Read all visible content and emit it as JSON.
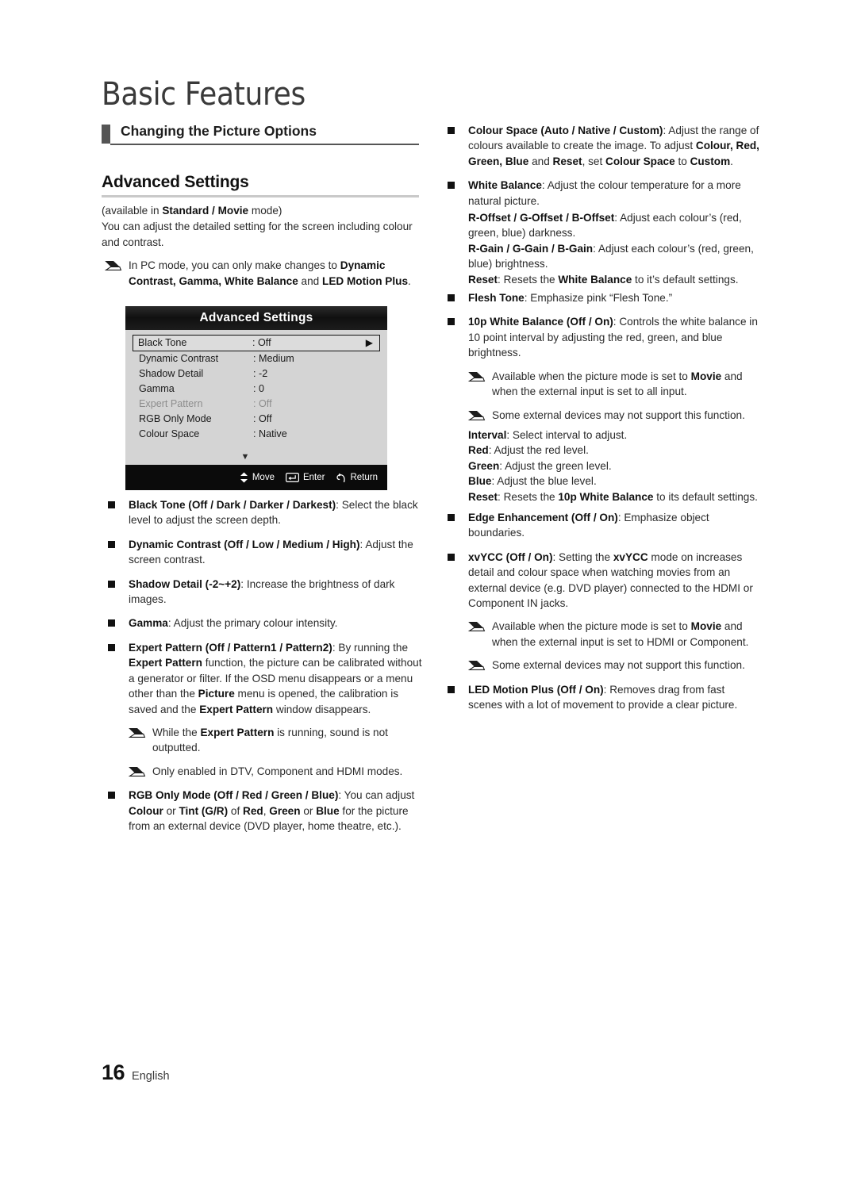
{
  "chapter": {
    "title": "Basic Features"
  },
  "section": {
    "label": "Changing the Picture Options"
  },
  "subsection": {
    "label": "Advanced Settings"
  },
  "intro": {
    "availability_prefix": "(available in ",
    "availability_bold": "Standard / Movie",
    "availability_suffix": " mode)",
    "description": "You can adjust the detailed setting for the screen including colour and contrast.",
    "note_pc_1": "In PC mode, you can only make changes to ",
    "note_pc_bold1": "Dynamic Contrast, Gamma, White Balance",
    "note_pc_2": " and ",
    "note_pc_bold2": "LED Motion Plus",
    "note_pc_3": "."
  },
  "osd": {
    "title": "Advanced Settings",
    "rows": [
      {
        "label": "Black Tone",
        "value": ": Off",
        "selected": true,
        "disabled": false,
        "arrow": "▶"
      },
      {
        "label": "Dynamic Contrast",
        "value": ": Medium",
        "selected": false,
        "disabled": false
      },
      {
        "label": "Shadow Detail",
        "value": ": -2",
        "selected": false,
        "disabled": false
      },
      {
        "label": "Gamma",
        "value": ": 0",
        "selected": false,
        "disabled": false
      },
      {
        "label": "Expert Pattern",
        "value": ": Off",
        "selected": false,
        "disabled": true
      },
      {
        "label": "RGB Only Mode",
        "value": ": Off",
        "selected": false,
        "disabled": false
      },
      {
        "label": "Colour Space",
        "value": ": Native",
        "selected": false,
        "disabled": false
      }
    ],
    "scroll_down": "▼",
    "footer": {
      "move": "Move",
      "enter": "Enter",
      "return": "Return"
    }
  },
  "left_column": {
    "black_tone": {
      "term": "Black Tone (Off / Dark / Darker / Darkest)",
      "text": ": Select the black level to adjust the screen depth."
    },
    "dynamic_contrast": {
      "term": "Dynamic Contrast (Off / Low / Medium / High)",
      "text": ": Adjust the screen contrast."
    },
    "shadow_detail": {
      "term": "Shadow Detail (-2~+2)",
      "text": ": Increase the brightness of dark images."
    },
    "gamma": {
      "term": "Gamma",
      "text": ": Adjust the primary colour intensity."
    },
    "expert_pattern": {
      "term": "Expert Pattern (Off / Pattern1 / Pattern2)",
      "t1": ": By running the ",
      "b1": "Expert Pattern",
      "t2": " function, the picture can be calibrated without a generator or filter. If the OSD menu disappears or a menu other than the ",
      "b2": "Picture",
      "t3": " menu is opened, the calibration is saved and the ",
      "b3": "Expert Pattern",
      "t4": " window disappears."
    },
    "note_sound": {
      "t1": "While the ",
      "b1": "Expert Pattern",
      "t2": " is running, sound is not outputted."
    },
    "note_modes": {
      "text": "Only enabled in DTV, Component and HDMI modes."
    },
    "rgb_only": {
      "term": "RGB Only Mode (Off / Red / Green / Blue)",
      "t1": ": You can adjust ",
      "b1": "Colour",
      "t2": " or ",
      "b2": "Tint (G/R)",
      "t3": " of ",
      "b3": "Red",
      "t4": ", ",
      "b4": "Green",
      "t5": " or ",
      "b5": "Blue",
      "t6": " for the picture from an external device (DVD player, home theatre, etc.)."
    }
  },
  "right_column": {
    "colour_space": {
      "term": "Colour Space (Auto / Native / Custom)",
      "t1": ": Adjust the range of colours available to create the image. To adjust ",
      "b1": "Colour, Red, Green, Blue",
      "t2": " and ",
      "b2": "Reset",
      "t3": ", set ",
      "b3": "Colour Space",
      "t4": " to ",
      "b4": "Custom",
      "t5": "."
    },
    "white_balance": {
      "term": "White Balance",
      "text": ": Adjust the colour temperature for a more natural picture."
    },
    "offsets": {
      "term": "R-Offset / G-Offset / B-Offset",
      "text": ": Adjust each colour’s (red, green, blue) darkness."
    },
    "gains": {
      "term": "R-Gain / G-Gain / B-Gain",
      "text": ": Adjust each colour’s (red, green, blue) brightness."
    },
    "wb_reset": {
      "term": "Reset",
      "t1": ": Resets the ",
      "b1": "White Balance",
      "t2": " to it’s default settings."
    },
    "flesh_tone": {
      "term": "Flesh Tone",
      "text": ": Emphasize pink “Flesh Tone.”"
    },
    "wb_10p": {
      "term": "10p White Balance (Off / On)",
      "text": ": Controls the white balance in 10 point interval by adjusting the red, green, and blue brightness."
    },
    "note_movie_all": {
      "t1": "Available when the picture mode is set to ",
      "b1": "Movie",
      "t2": " and when the external input is set to all input."
    },
    "note_unsupported_1": {
      "text": "Some external devices may not support this function."
    },
    "interval": {
      "term": "Interval",
      "text": ": Select interval to adjust."
    },
    "red": {
      "term": "Red",
      "text": ": Adjust the red level."
    },
    "green": {
      "term": "Green",
      "text": ": Adjust the green level."
    },
    "blue": {
      "term": "Blue",
      "text": ": Adjust the blue level."
    },
    "reset_10p": {
      "term": "Reset",
      "t1": ": Resets the ",
      "b1": "10p White Balance",
      "t2": " to its default settings."
    },
    "edge_enhancement": {
      "term": "Edge Enhancement (Off / On)",
      "text": ": Emphasize object boundaries."
    },
    "xvycc": {
      "term": "xvYCC (Off / On)",
      "t1": ": Setting the ",
      "b1": "xvYCC",
      "t2": " mode on increases detail and colour space when watching movies from an external device (e.g. DVD player) connected to the HDMI or Component IN jacks."
    },
    "note_movie_hdmi": {
      "t1": "Available when the picture mode is set to ",
      "b1": "Movie",
      "t2": " and when the external input is set to HDMI or Component."
    },
    "note_unsupported_2": {
      "text": "Some external devices may not support this function."
    },
    "led_motion_plus": {
      "term": "LED Motion Plus (Off / On)",
      "text": ": Removes drag from fast scenes with a lot of movement to provide a clear picture."
    }
  },
  "footer": {
    "page_number": "16",
    "language": "English"
  }
}
